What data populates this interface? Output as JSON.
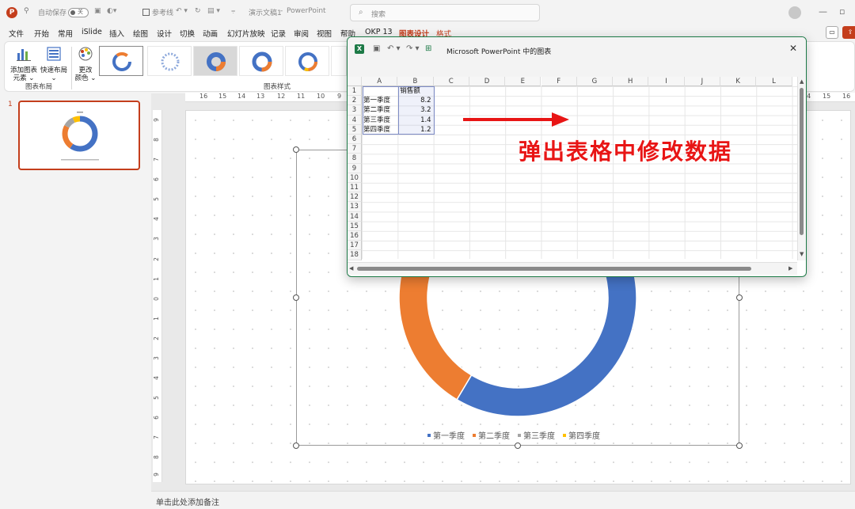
{
  "titlebar": {
    "autosave_label": "自动保存",
    "autosave_state": "关",
    "ref_label": "参考线",
    "doc_name": "演示文稿1",
    "separator": "-",
    "app_name": "PowerPoint",
    "search_placeholder": "搜索"
  },
  "menu": {
    "tabs": [
      "文件",
      "开始",
      "常用",
      "iSlide",
      "插入",
      "绘图",
      "设计",
      "切换",
      "动画",
      "幻灯片放映",
      "记录",
      "审阅",
      "视图",
      "帮助",
      "OKP 13",
      "图表设计",
      "格式"
    ],
    "active": "图表设计",
    "context": "格式"
  },
  "ribbon": {
    "add_element_label": "添加图表元素",
    "add_element_line1": "添加图表",
    "add_element_line2": "元素",
    "quick_layout_line1": "快速布局",
    "change_color_line1": "更改",
    "change_color_line2": "颜色",
    "group_layout_label": "图表布局",
    "group_style_label": "图表样式"
  },
  "thumbnails": {
    "slide_number": "1"
  },
  "ruler": {
    "top": [
      "16",
      "15",
      "14",
      "13",
      "12",
      "11",
      "10",
      "9",
      "10",
      "11",
      "12",
      "13",
      "14",
      "15",
      "16"
    ],
    "left": [
      "9",
      "8",
      "7",
      "6",
      "5",
      "4",
      "3",
      "2",
      "1",
      "0",
      "1",
      "2",
      "3",
      "4",
      "5",
      "6",
      "7",
      "8",
      "9"
    ]
  },
  "chart_data": {
    "type": "pie",
    "variant": "doughnut",
    "categories": [
      "第一季度",
      "第二季度",
      "第三季度",
      "第四季度"
    ],
    "series": [
      {
        "name": "销售额",
        "values": [
          8.2,
          3.2,
          1.4,
          1.2
        ]
      }
    ],
    "colors": [
      "#4472c4",
      "#ed7d31",
      "#a5a5a5",
      "#ffc000"
    ],
    "legend": "bottom"
  },
  "popup": {
    "title": "Microsoft PowerPoint 中的图表",
    "columns": [
      "A",
      "B",
      "C",
      "D",
      "E",
      "F",
      "G",
      "H",
      "I",
      "J",
      "K",
      "L"
    ],
    "rows": [
      "1",
      "2",
      "3",
      "4",
      "5",
      "6",
      "7",
      "8",
      "9",
      "10",
      "11",
      "12",
      "13",
      "14",
      "15",
      "16",
      "17",
      "18"
    ],
    "header_b": "销售额",
    "cells": [
      {
        "a": "第一季度",
        "b": "8.2"
      },
      {
        "a": "第二季度",
        "b": "3.2"
      },
      {
        "a": "第三季度",
        "b": "1.4"
      },
      {
        "a": "第四季度",
        "b": "1.2"
      }
    ]
  },
  "annotation_text": "弹出表格中修改数据",
  "notes_placeholder": "单击此处添加备注",
  "colors": {
    "accent": "#c43e1c",
    "excel": "#1d7a47",
    "annotation": "#e81515"
  }
}
